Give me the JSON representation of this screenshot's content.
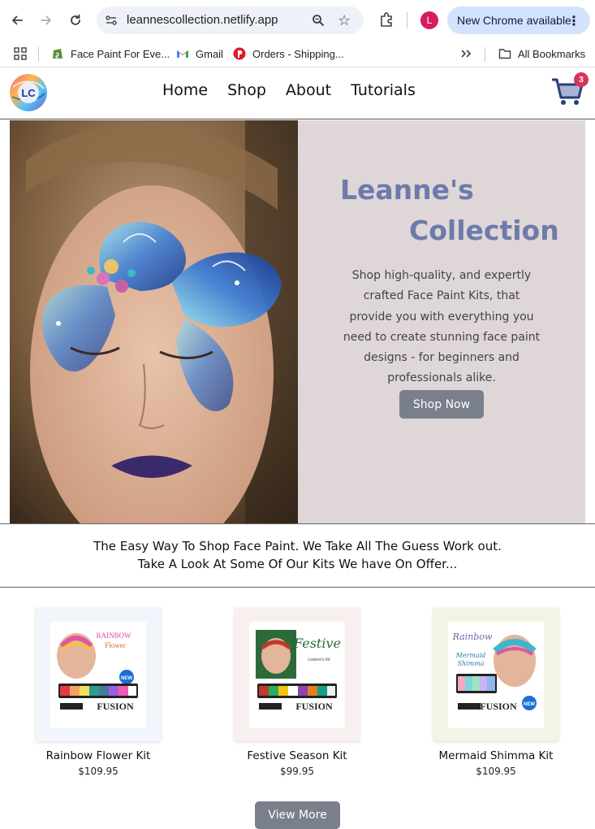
{
  "browser": {
    "url": "leannescollection.netlify.app",
    "profile_initial": "L",
    "update_label": "New Chrome available"
  },
  "bookmarks": [
    {
      "label": "Face Paint For Eve...",
      "icon": "shopify-icon"
    },
    {
      "label": "Gmail",
      "icon": "gmail-icon"
    },
    {
      "label": "Orders - Shipping...",
      "icon": "orders-icon"
    }
  ],
  "all_bookmarks_label": "All Bookmarks",
  "site": {
    "logo_text": "LC",
    "nav": [
      "Home",
      "Shop",
      "About",
      "Tutorials"
    ],
    "cart_count": "3"
  },
  "hero": {
    "title_line1": "Leanne's",
    "title_line2": "Collection",
    "text": "Shop high-quality, and expertly crafted Face Paint Kits, that provide you with everything you need to create stunning face paint designs - for beginners and professionals alike.",
    "button": "Shop Now"
  },
  "tagline": {
    "line1": "The Easy Way To Shop Face Paint. We Take All The Guess Work out.",
    "line2": "Take A Look At Some Of Our Kits We have On Offer..."
  },
  "products": [
    {
      "name": "Rainbow Flower Kit",
      "price": "$109.95",
      "card_bg": "#f1f6fc"
    },
    {
      "name": "Festive Season Kit",
      "price": "$99.95",
      "card_bg": "#f7f0ef"
    },
    {
      "name": "Mermaid Shimma Kit",
      "price": "$109.95",
      "card_bg": "#f4f4e6"
    }
  ],
  "view_more": "View More",
  "colors": {
    "accent": "#6d7aab",
    "button": "#7a7f8c",
    "hero_bg": "#ded6d7",
    "badge": "#d6335b"
  }
}
